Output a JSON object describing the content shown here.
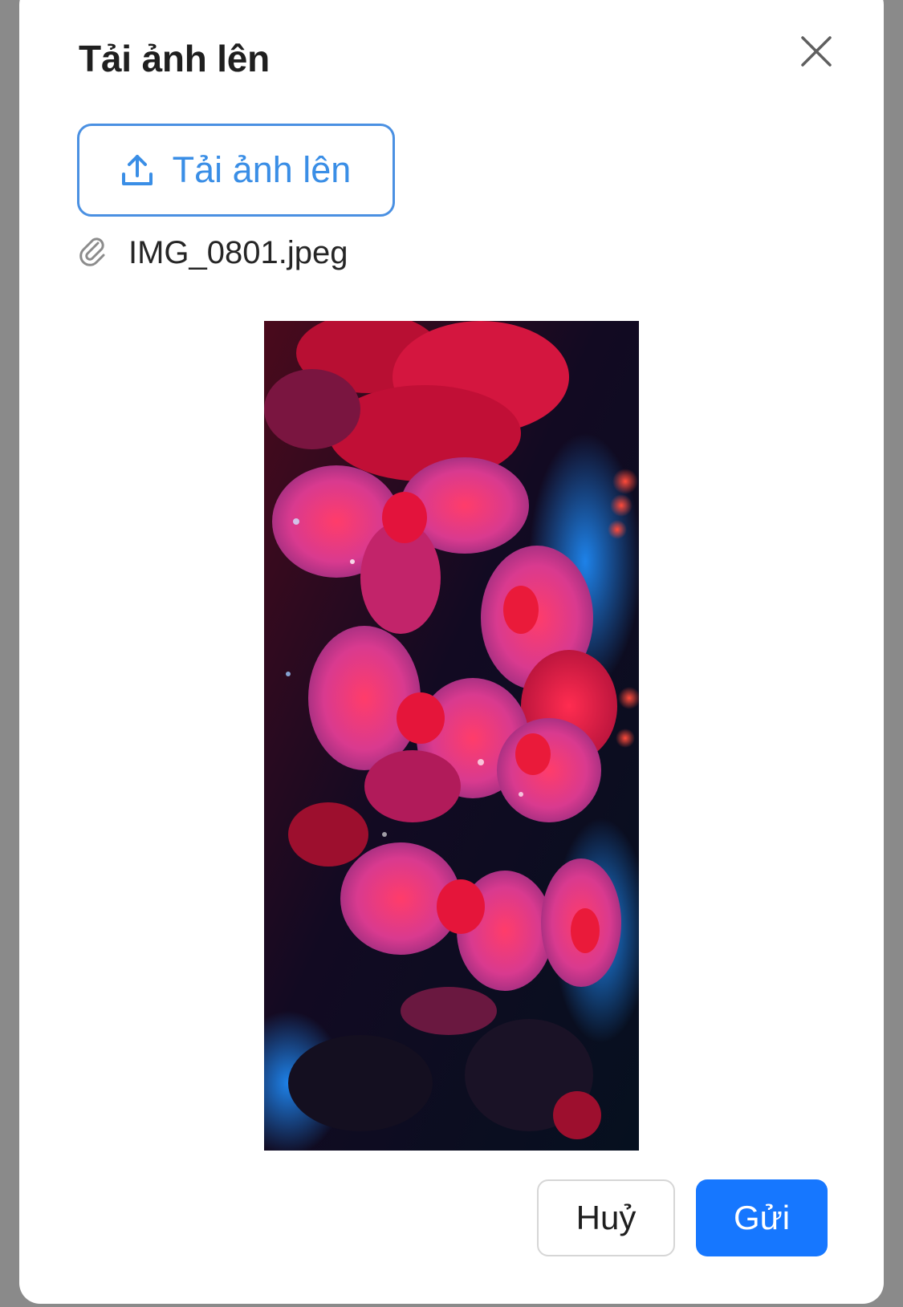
{
  "dialog": {
    "title": "Tải ảnh lên",
    "close_icon": "close-icon"
  },
  "upload": {
    "button_label": "Tải ảnh lên",
    "icon": "upload-icon"
  },
  "file": {
    "name": "IMG_0801.jpeg",
    "icon": "paperclip-icon"
  },
  "preview": {
    "subject": "image-preview"
  },
  "footer": {
    "cancel_label": "Huỷ",
    "send_label": "Gửi"
  },
  "colors": {
    "primary": "#1677ff",
    "upload_border": "#4a90e2",
    "upload_text": "#3a8ee6",
    "overlay": "#8a8a8a"
  }
}
